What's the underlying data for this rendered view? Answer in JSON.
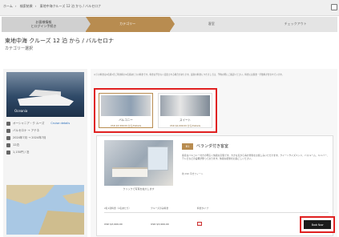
{
  "breadcrumb": [
    "ホーム",
    "検索結果",
    "東地中海クルーズ 12 泊 から / バルセロナ"
  ],
  "steps": [
    {
      "label": "お客様情報\nとログイン手続き"
    },
    {
      "label": "カテゴリー"
    },
    {
      "label": "客室"
    },
    {
      "label": "チェックアウト"
    }
  ],
  "page": {
    "title": "東地中海 クルーズ 12 泊 から / バルセロナ",
    "subtitle": "カテゴリー選択"
  },
  "sidebar": {
    "ship_label": "Oceania",
    "info": [
      {
        "text": "オーシャニア・ク ルーズ",
        "link": "Cruise details"
      },
      {
        "text": "バルセロナ → アテネ"
      },
      {
        "text": "2024年7月 → 2024年7月"
      },
      {
        "text": "12泊"
      },
      {
        "text": "1,150円 / 泊"
      }
    ]
  },
  "notice": "以下の料金は2名様1室ご利用時の1名様あたりの料金です。料金は予告なく変更される場合があります。最新の料金につきましては、予約の際にご確認ください。料金には税金・手数料が含まれています。",
  "categories": [
    {
      "name": "バルコニー",
      "price": "USD $3,999.00 から/Details"
    },
    {
      "name": "スイート",
      "price": "USD $4,699.00 から/Details"
    }
  ],
  "room": {
    "code": "B1",
    "title": "ベランダ付き客室",
    "description": "客室はバルコニー付きの明るく快適な空間です。大きな窓から海の景色をお楽しみいただけます。クイーンサイズベッド、バスルーム、ミニバー、テレビなどの設備が整っております。快適な船旅をお過ごしください。",
    "size": "約 290 平方フィート",
    "photo_caption": "クリックで写真を拡大します"
  },
  "fare_table": {
    "headers": [
      "2名1室料金（1名あたり）",
      "クルーズのみ料金",
      "料金タイプ",
      ""
    ],
    "rows": [
      {
        "price1": "USD $3,999.00",
        "price2": "USD $3,999.00"
      }
    ]
  },
  "book_button": "Book Now"
}
